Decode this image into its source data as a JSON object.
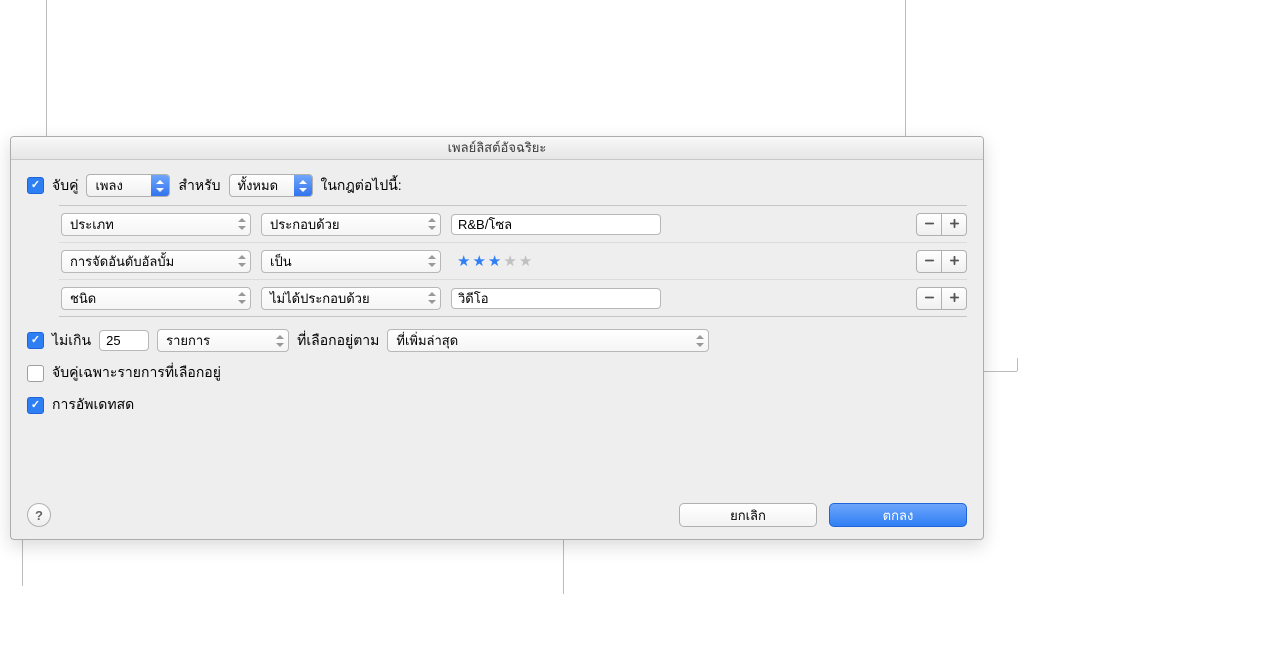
{
  "title": "เพลย์ลิสต์อัจฉริยะ",
  "match": {
    "checkbox_label": "จับคู่",
    "type_value": "เพลง",
    "for_label": "สำหรับ",
    "scope_value": "ทั้งหมด",
    "suffix_label": "ในกฎต่อไปนี้:"
  },
  "rules": [
    {
      "field": "ประเภท",
      "operator": "ประกอบด้วย",
      "value": "R&B/โซล",
      "kind": "text"
    },
    {
      "field": "การจัดอันดับอัลบั้ม",
      "operator": "เป็น",
      "value": 3,
      "kind": "stars"
    },
    {
      "field": "ชนิด",
      "operator": "ไม่ได้ประกอบด้วย",
      "value": "วิดีโอ",
      "kind": "text"
    }
  ],
  "limit": {
    "label": "ไม่เกิน",
    "count": "25",
    "unit_value": "รายการ",
    "selected_by_label": "ที่เลือกอยู่ตาม",
    "order_value": "ที่เพิ่มล่าสุด"
  },
  "only_checked_label": "จับคู่เฉพาะรายการที่เลือกอยู่",
  "live_update_label": "การอัพเดทสด",
  "buttons": {
    "cancel": "ยกเลิก",
    "ok": "ตกลง"
  },
  "checks": {
    "match": true,
    "limit": true,
    "only_checked": false,
    "live_update": true
  }
}
